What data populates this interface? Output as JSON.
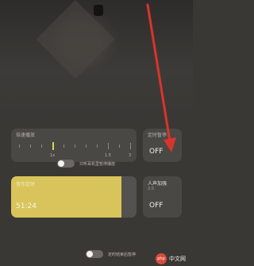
{
  "speed": {
    "title": "倍速播放",
    "active_label": "1x",
    "end_labels": [
      "1.5",
      "3"
    ]
  },
  "timer_toggle": {
    "title": "定时暂停",
    "state": "OFF"
  },
  "switch1": {
    "label": "只听耳机里暂停播放"
  },
  "timer": {
    "title": "音乐定时",
    "time": "51:24",
    "fill_fraction": 0.88
  },
  "vocal": {
    "title": "人声加强",
    "subtitle": "2.0",
    "state": "OFF"
  },
  "switch2": {
    "label": "定时结束后暂停"
  },
  "watermark": {
    "badge": "php",
    "text": "中文网"
  },
  "colors": {
    "accent": "#d8c45a",
    "arrow": "#d9342b"
  }
}
